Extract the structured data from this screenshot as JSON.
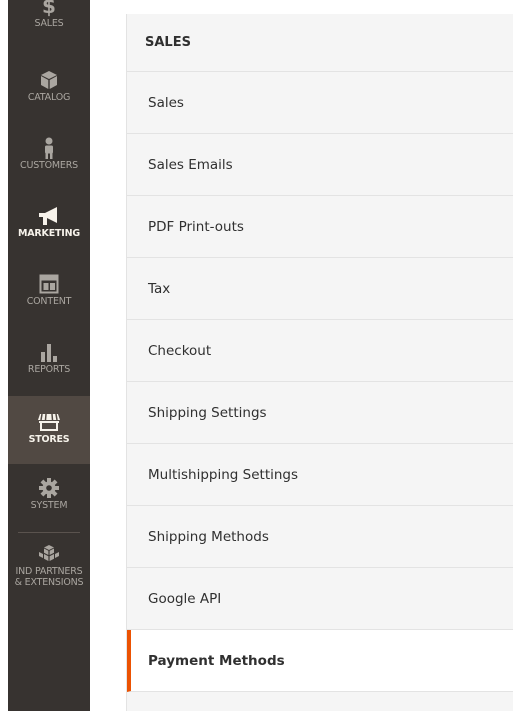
{
  "admin_nav": {
    "items": [
      {
        "label": "SALES",
        "icon": "dollar-icon"
      },
      {
        "label": "CATALOG",
        "icon": "box-icon"
      },
      {
        "label": "CUSTOMERS",
        "icon": "person-icon"
      },
      {
        "label": "MARKETING",
        "icon": "megaphone-icon"
      },
      {
        "label": "CONTENT",
        "icon": "layout-icon"
      },
      {
        "label": "REPORTS",
        "icon": "bar-chart-icon"
      },
      {
        "label": "STORES",
        "icon": "storefront-icon"
      },
      {
        "label": "SYSTEM",
        "icon": "gear-icon"
      },
      {
        "label_line1": "IND PARTNERS",
        "label_line2": "& EXTENSIONS",
        "icon": "cubes-icon"
      }
    ],
    "active": "STORES"
  },
  "config_tabs": {
    "section_title": "SALES",
    "items": [
      {
        "label": "Sales"
      },
      {
        "label": "Sales Emails"
      },
      {
        "label": "PDF Print-outs"
      },
      {
        "label": "Tax"
      },
      {
        "label": "Checkout"
      },
      {
        "label": "Shipping Settings"
      },
      {
        "label": "Multishipping Settings"
      },
      {
        "label": "Shipping Methods"
      },
      {
        "label": "Google API"
      },
      {
        "label": "Payment Methods"
      }
    ],
    "active": "Payment Methods"
  },
  "colors": {
    "nav_background": "#373330",
    "nav_active_background": "#514943",
    "active_accent": "#eb5202",
    "tab_background": "#f5f5f5"
  }
}
